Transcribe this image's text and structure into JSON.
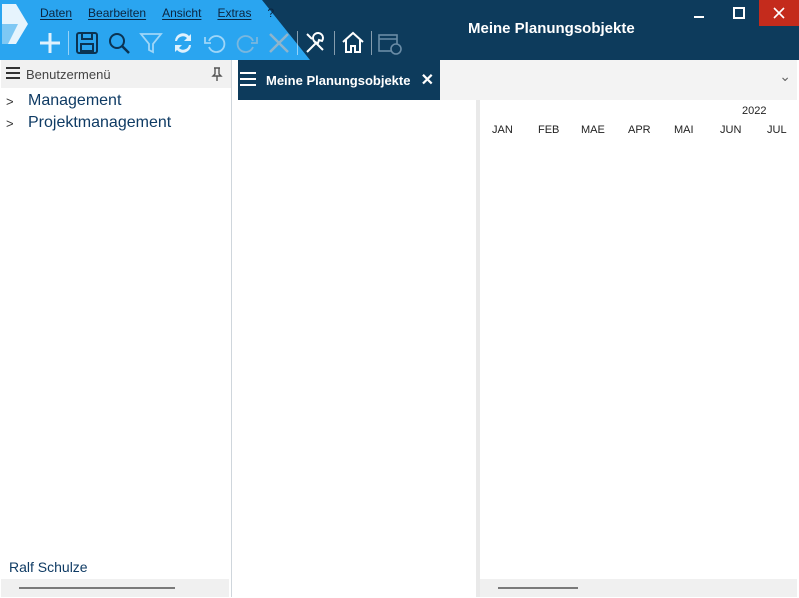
{
  "window": {
    "title": "Meine Planungsobjekte"
  },
  "menu": {
    "items": [
      "Daten",
      "Bearbeiten",
      "Ansicht",
      "Extras",
      "?"
    ]
  },
  "toolbar": {
    "icons": [
      "add-icon",
      "save-icon",
      "search-icon",
      "filter-icon",
      "refresh-icon",
      "undo-icon",
      "redo-icon",
      "cancel-icon",
      "tools-icon",
      "home-icon",
      "calendar-icon"
    ]
  },
  "left_panel": {
    "header": "Benutzermenü",
    "items": [
      {
        "label": "Management"
      },
      {
        "label": "Projektmanagement"
      }
    ],
    "user": "Ralf Schulze"
  },
  "tabs": [
    {
      "label": "Meine Planungsobjekte",
      "close_glyph": "✕"
    }
  ],
  "gantt": {
    "year": "2022",
    "months": [
      "JAN",
      "FEB",
      "MAE",
      "APR",
      "MAI",
      "JUN",
      "JUL"
    ]
  },
  "colors": {
    "accent": "#2aa5f0",
    "dark": "#0d3b5c",
    "close": "#c42b1c"
  }
}
